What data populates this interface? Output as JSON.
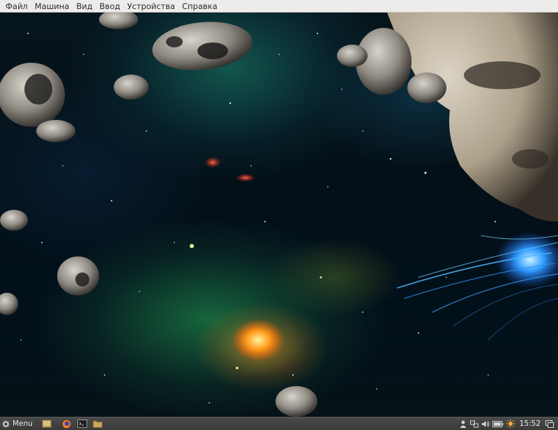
{
  "menubar": {
    "items": [
      "Файл",
      "Машина",
      "Вид",
      "Ввод",
      "Устройства",
      "Справка"
    ]
  },
  "desktop": {
    "wallpaper": "space-asteroids-wallpaper",
    "accent_colors": {
      "nebula_green": "#2fa86a",
      "nebula_orange": "#ff9a2a",
      "energy_blue": "#3aa8ff",
      "asteroid": "#9e988e"
    }
  },
  "panel": {
    "menu_label": "Menu",
    "menu_icon": "gear-icon",
    "launchers": [
      {
        "name": "show-desktop-icon"
      },
      {
        "name": "firefox-icon"
      },
      {
        "name": "terminal-icon"
      },
      {
        "name": "files-folder-icon"
      }
    ],
    "tray": [
      {
        "name": "user-icon"
      },
      {
        "name": "network-icon"
      },
      {
        "name": "volume-icon"
      },
      {
        "name": "battery-icon"
      },
      {
        "name": "update-sun-icon"
      }
    ],
    "clock": "15:52",
    "show_desktop_tray": "show-desktop-tray-icon"
  }
}
